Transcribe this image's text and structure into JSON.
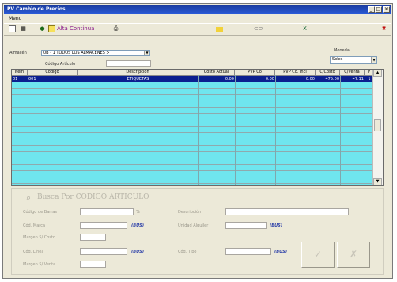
{
  "window": {
    "title": "PV Cambio de Precios"
  },
  "menu": {
    "items": [
      "Menu"
    ]
  },
  "toolbar": {
    "alta_label": "Alta Continua"
  },
  "filters": {
    "almacen_label": "Almacén",
    "almacen_value": "0B - 1 TODOS LOS ALMACENES >",
    "codigo_label": "Código Artículo",
    "codigo_value": "",
    "moneda_label": "Moneda",
    "moneda_value": "Soles"
  },
  "grid": {
    "columns": [
      "Item",
      "Código",
      "Descripción",
      "Costo Actual",
      "PVP Co",
      "PVP Co. Inci",
      "C/Costo",
      "C/Venta",
      "P"
    ],
    "rows": [
      {
        "item": "01",
        "codigo": "001",
        "descripcion": "ETIQUETAS",
        "costo": "0.00",
        "pvp": "0.00",
        "pvp_inci": "0.00",
        "ccosto": "475.00",
        "cventa": "47.11",
        "p": "1"
      }
    ]
  },
  "panel": {
    "title": "Busca Por CODIGO ARTICULO",
    "fields": {
      "codigo_barras": "Código de Barras",
      "cod_marca": "Cód. Marca",
      "margen_costo": "Margen S/ Costo",
      "cod_linea": "Cód. Línea",
      "margen_venta": "Margen S/ Venta",
      "descripcion": "Descripción",
      "unidad": "Unidad Alquiler",
      "cod_tipo": "Cód. Tipo"
    },
    "link_text": "(BUS)"
  }
}
